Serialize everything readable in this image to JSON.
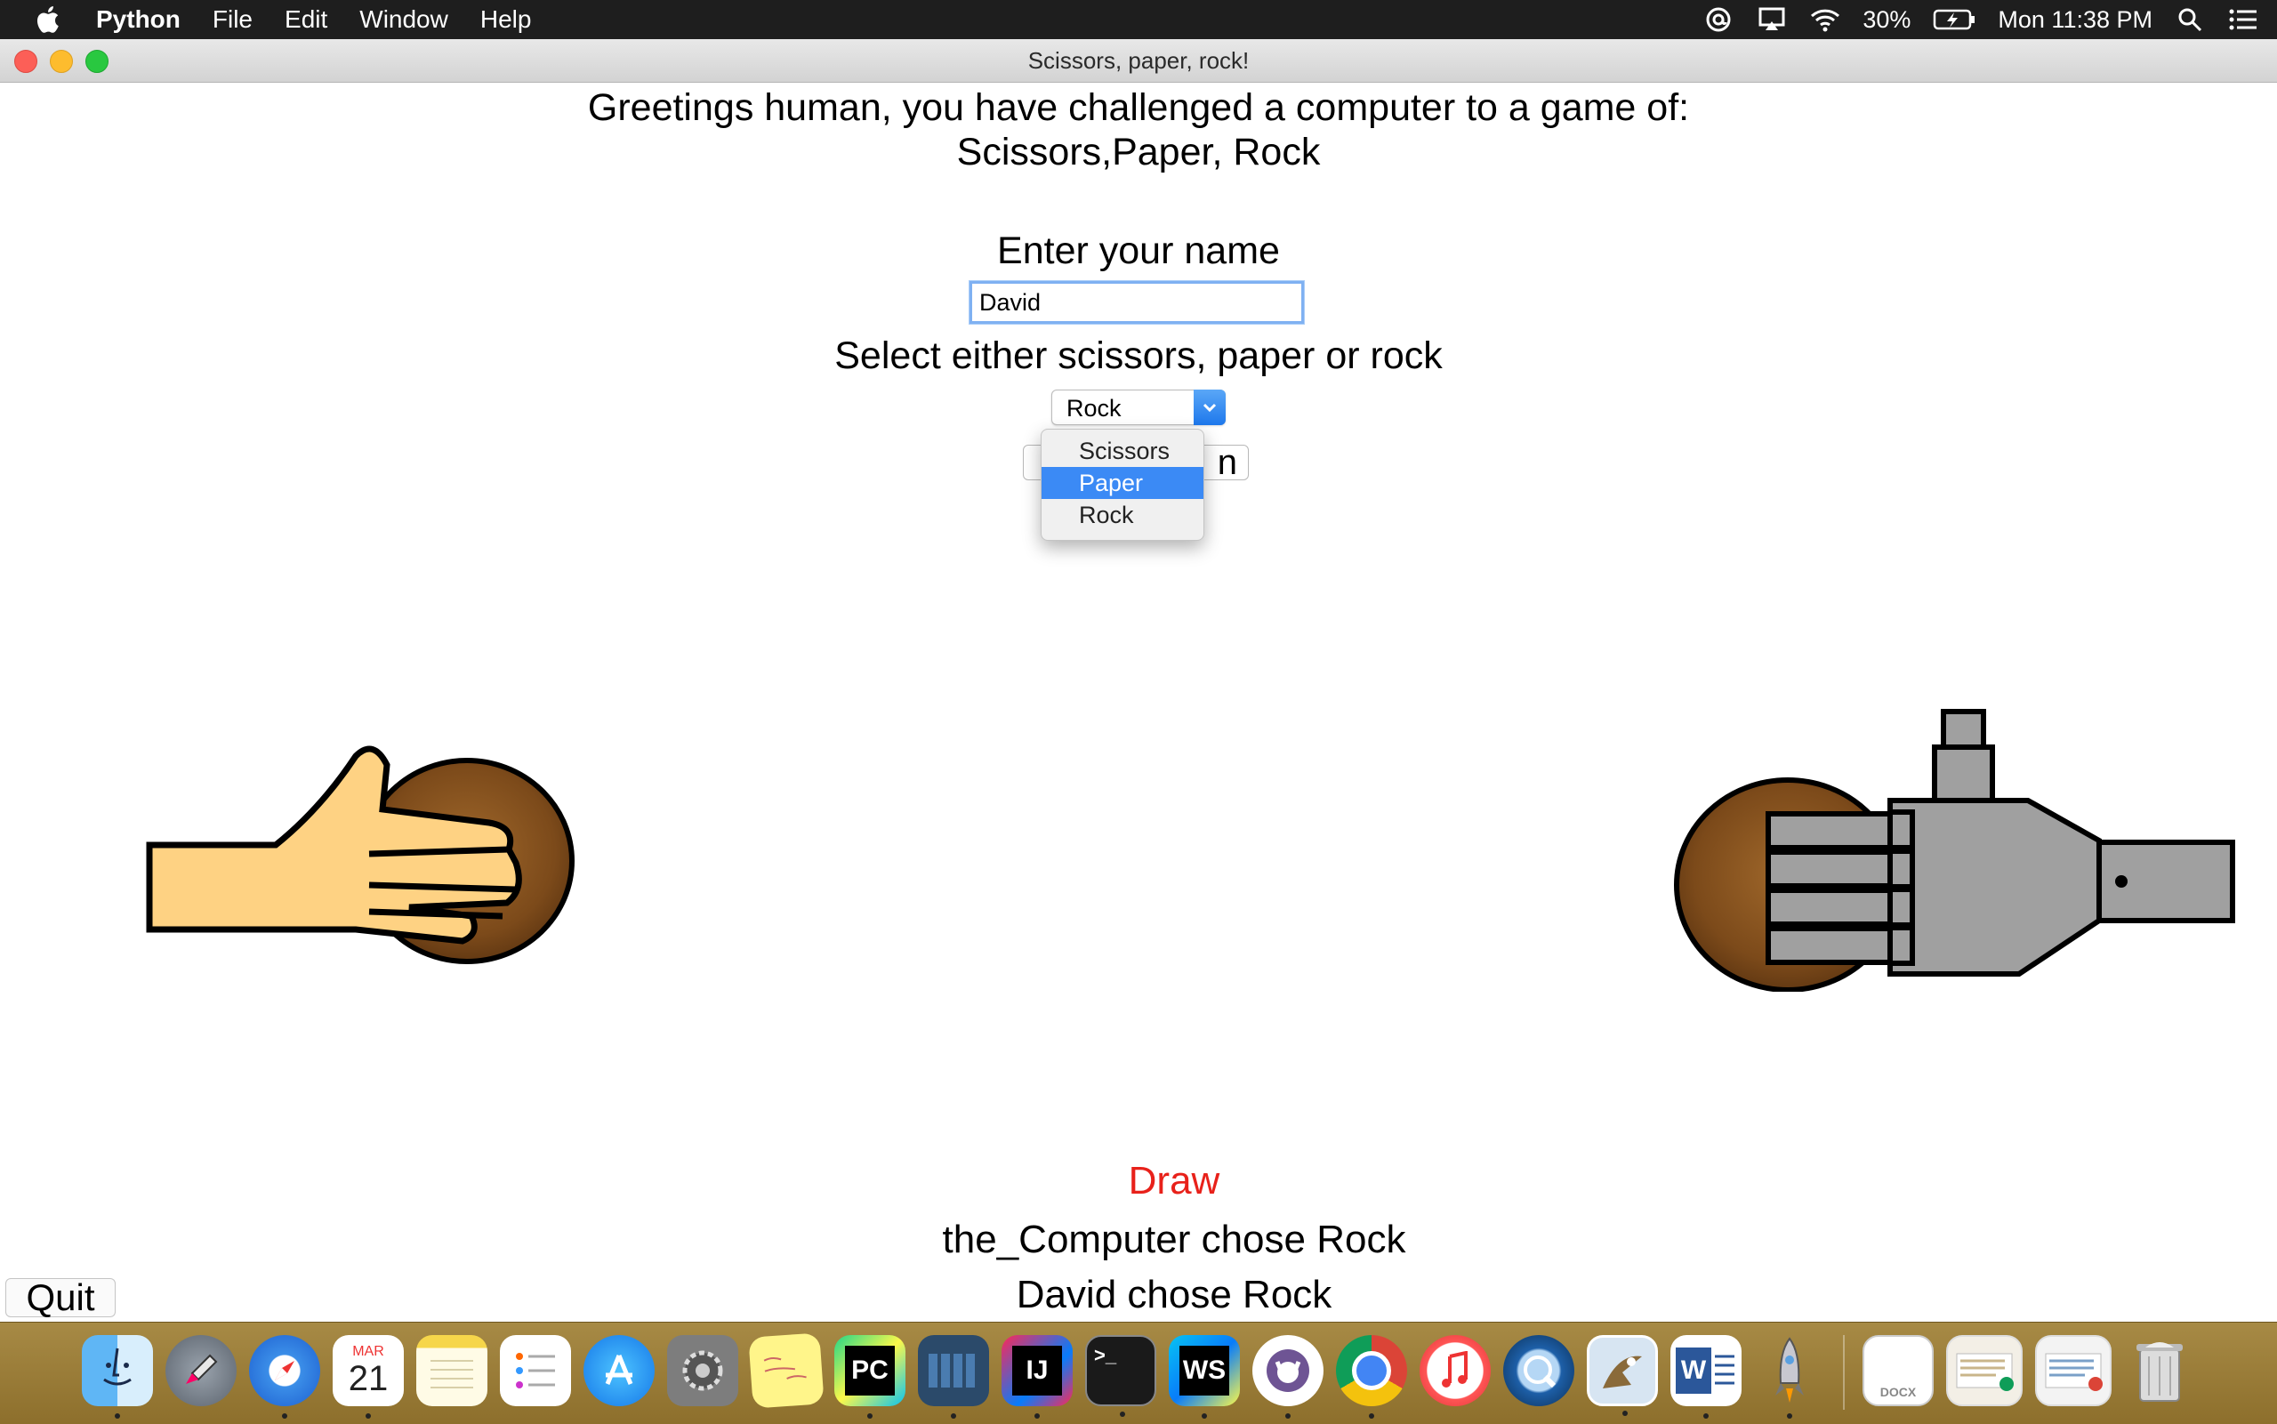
{
  "menubar": {
    "app": "Python",
    "items": [
      "File",
      "Edit",
      "Window",
      "Help"
    ],
    "battery": "30%",
    "clock": "Mon 11:38 PM"
  },
  "window": {
    "title": "Scissors, paper, rock!"
  },
  "game": {
    "greeting_line1": "Greetings human, you have challenged a computer to a game of:",
    "greeting_line2": "Scissors,Paper, Rock",
    "name_label": "Enter your name",
    "name_value": "David",
    "select_label": "Select either scissors, paper or rock",
    "selected": "Rock",
    "options": [
      "Scissors",
      "Paper",
      "Rock"
    ],
    "highlighted_option": "Paper",
    "go_button_visible": "n",
    "result": "Draw",
    "result_color": "#e8211a",
    "computer_line": "the_Computer chose Rock",
    "user_line": "David chose Rock",
    "quit_label": "Quit"
  },
  "dock": {
    "icons": [
      "finder-icon",
      "launchpad-icon",
      "safari-icon",
      "calendar-icon",
      "notes-icon",
      "reminders-icon",
      "app-store-icon",
      "system-preferences-icon",
      "stickies-icon",
      "pycharm-icon",
      "flashcard-icon",
      "intellij-icon",
      "terminal-icon",
      "webstorm-icon",
      "github-icon",
      "chrome-icon",
      "itunes-icon",
      "quicktime-icon",
      "preview-icon",
      "word-icon",
      "rocket-icon"
    ],
    "calendar_month": "MAR",
    "calendar_day": "21",
    "pycharm_label": "PC",
    "intellij_label": "IJ",
    "webstorm_label": "WS",
    "word_label": "W",
    "terminal_label": ">_",
    "docx_label": "DOCX"
  }
}
